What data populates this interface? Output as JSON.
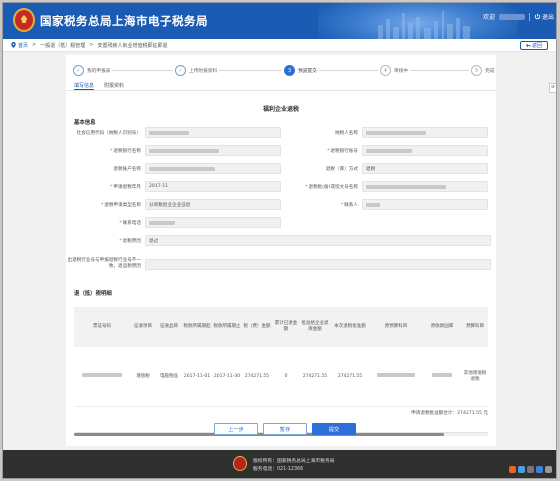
{
  "header": {
    "title": "国家税务总局上海市电子税务局",
    "welcome": "欢迎",
    "exit_label": "退出"
  },
  "navbar": {
    "home": "首页",
    "crumb1": "一般退（抵）税管理",
    "crumb2": "安置残疾人就业增值税即征即退",
    "back_label": "返回"
  },
  "steps": [
    {
      "num": "1",
      "label": "我的申报表",
      "state": "done"
    },
    {
      "num": "2",
      "label": "上传附报资料",
      "state": "done"
    },
    {
      "num": "3",
      "label": "预览提交",
      "state": "current"
    },
    {
      "num": "4",
      "label": "审核中",
      "state": "todo"
    },
    {
      "num": "5",
      "label": "完成",
      "state": "todo"
    }
  ],
  "tabs": [
    "填写信息",
    "附报资料"
  ],
  "form": {
    "title": "福利企业退税",
    "basic_section": "基本信息",
    "fields": {
      "tax_id": {
        "label": "社会信用代码（纳税人识别号）"
      },
      "taxpayer_name": {
        "label": "纳税人名称"
      },
      "bank_name": {
        "label": "退税银行名称"
      },
      "bank_account": {
        "label": "退税银行账号"
      },
      "account_name": {
        "label": "退税账户名称"
      },
      "refund_method": {
        "label": "退税（库）方式",
        "value": "退税"
      },
      "apply_period": {
        "label": "申请退税年月",
        "value": "2017-11"
      },
      "approval_doc": {
        "label": "退税批(备)或指文号名称"
      },
      "refund_type": {
        "label": "退税申请类型名称",
        "value": "分商税退业企业征退"
      },
      "contact": {
        "label": "联系人"
      },
      "phone": {
        "label": "联系电话"
      },
      "reason": {
        "label": "退税原因",
        "value": "退过"
      },
      "excess": {
        "label": "出退税行业号与申报退税行业号不一致，退运税原因"
      }
    }
  },
  "detail": {
    "section": "退（抵）税明细",
    "headers": [
      "票证号码",
      "征收项目",
      "征收品目",
      "税款所属期起",
      "税款所属期止",
      "税（费）金额",
      "累计已退金额",
      "批准给企业退库金额",
      "本次退税批准额",
      "原预算科目",
      "原收款国库",
      "预算科目"
    ],
    "row": [
      "",
      "增值税",
      "电脑物品",
      "2017-11-01",
      "2017-11-30",
      "274271.55",
      "0",
      "274271.55",
      "274271.55",
      "",
      "",
      "其他增值税退税"
    ],
    "total": "申请退税批准额合计：274271.55 元"
  },
  "buttons": {
    "prev": "上一步",
    "save": "暂存",
    "submit": "提交"
  },
  "footer": {
    "line1": "版权所有：国家税务总局上海市税务局",
    "line2": "服务电话：021-12366"
  },
  "colors": {
    "brand_blue": "#1b5bb4",
    "button_blue": "#2c6fd6",
    "required_red": "#e0413c"
  }
}
